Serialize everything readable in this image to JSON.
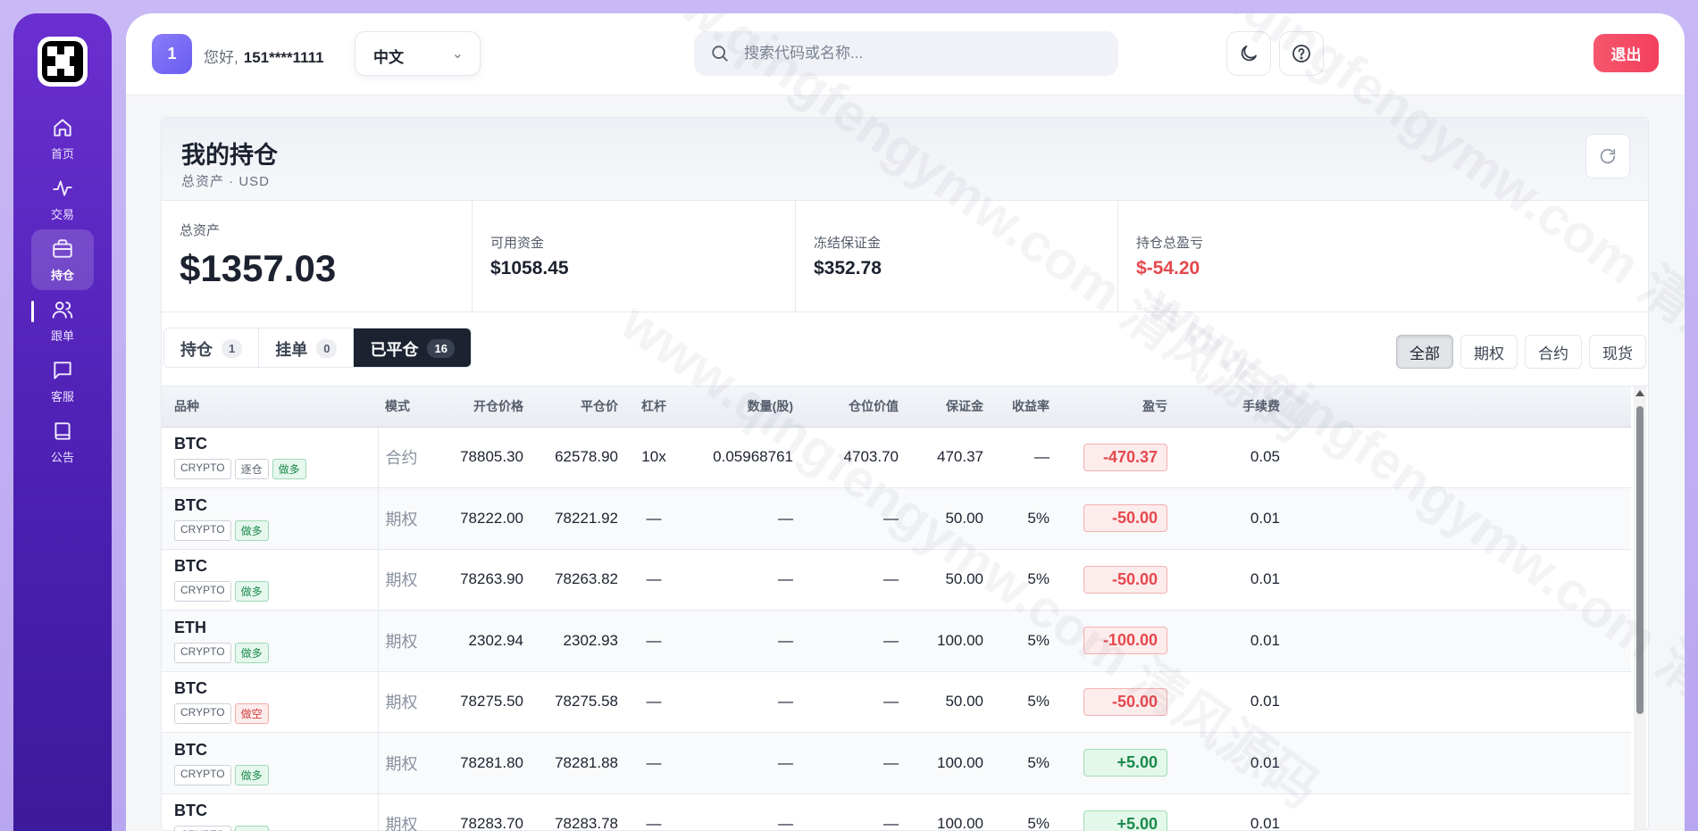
{
  "sidebar": {
    "items": [
      {
        "label": "首页",
        "icon": "home-icon"
      },
      {
        "label": "交易",
        "icon": "activity-icon"
      },
      {
        "label": "持仓",
        "icon": "briefcase-icon",
        "active": true
      },
      {
        "label": "跟单",
        "icon": "users-icon"
      },
      {
        "label": "客服",
        "icon": "message-icon"
      },
      {
        "label": "公告",
        "icon": "book-icon"
      }
    ]
  },
  "header": {
    "avatar_text": "1",
    "greeting": "您好,",
    "username": "151****1111",
    "language": "中文",
    "search_placeholder": "搜索代码或名称...",
    "logout_label": "退出"
  },
  "portfolio": {
    "title": "我的持仓",
    "subtitle": "总资产 · USD",
    "stats": [
      {
        "label": "总资产",
        "value": "$1357.03"
      },
      {
        "label": "可用资金",
        "value": "$1058.45"
      },
      {
        "label": "冻结保证金",
        "value": "$352.78"
      },
      {
        "label": "持仓总盈亏",
        "value": "$-54.20"
      }
    ]
  },
  "tabs": [
    {
      "label": "持仓",
      "count": "1"
    },
    {
      "label": "挂单",
      "count": "0"
    },
    {
      "label": "已平仓",
      "count": "16",
      "active": true
    }
  ],
  "filters": [
    "全部",
    "期权",
    "合约",
    "现货"
  ],
  "table": {
    "columns": [
      "品种",
      "模式",
      "开仓价格",
      "平仓价",
      "杠杆",
      "数量(股)",
      "仓位价值",
      "保证金",
      "收益率",
      "盈亏",
      "手续费"
    ],
    "rows": [
      {
        "symbol": "BTC",
        "tags": [
          "CRYPTO",
          "逐仓",
          "做多"
        ],
        "mode": "合约",
        "open": "78805.30",
        "close": "62578.90",
        "leverage": "10x",
        "qty": "0.05968761",
        "value": "4703.70",
        "margin": "470.37",
        "yield": "—",
        "pnl": "-470.37",
        "fee": "0.05"
      },
      {
        "symbol": "BTC",
        "tags": [
          "CRYPTO",
          "做多"
        ],
        "mode": "期权",
        "open": "78222.00",
        "close": "78221.92",
        "leverage": "—",
        "qty": "—",
        "value": "—",
        "margin": "50.00",
        "yield": "5%",
        "pnl": "-50.00",
        "fee": "0.01"
      },
      {
        "symbol": "BTC",
        "tags": [
          "CRYPTO",
          "做多"
        ],
        "mode": "期权",
        "open": "78263.90",
        "close": "78263.82",
        "leverage": "—",
        "qty": "—",
        "value": "—",
        "margin": "50.00",
        "yield": "5%",
        "pnl": "-50.00",
        "fee": "0.01"
      },
      {
        "symbol": "ETH",
        "tags": [
          "CRYPTO",
          "做多"
        ],
        "mode": "期权",
        "open": "2302.94",
        "close": "2302.93",
        "leverage": "—",
        "qty": "—",
        "value": "—",
        "margin": "100.00",
        "yield": "5%",
        "pnl": "-100.00",
        "fee": "0.01"
      },
      {
        "symbol": "BTC",
        "tags": [
          "CRYPTO",
          "做空"
        ],
        "mode": "期权",
        "open": "78275.50",
        "close": "78275.58",
        "leverage": "—",
        "qty": "—",
        "value": "—",
        "margin": "50.00",
        "yield": "5%",
        "pnl": "-50.00",
        "fee": "0.01"
      },
      {
        "symbol": "BTC",
        "tags": [
          "CRYPTO",
          "做多"
        ],
        "mode": "期权",
        "open": "78281.80",
        "close": "78281.88",
        "leverage": "—",
        "qty": "—",
        "value": "—",
        "margin": "100.00",
        "yield": "5%",
        "pnl": "+5.00",
        "fee": "0.01"
      },
      {
        "symbol": "BTC",
        "tags": [
          "CRYPTO",
          "做多"
        ],
        "mode": "期权",
        "open": "78283.70",
        "close": "78283.78",
        "leverage": "—",
        "qty": "—",
        "value": "—",
        "margin": "100.00",
        "yield": "5%",
        "pnl": "+5.00",
        "fee": "0.01"
      }
    ]
  },
  "watermark": "www.qingfengymw.com 清风源码"
}
